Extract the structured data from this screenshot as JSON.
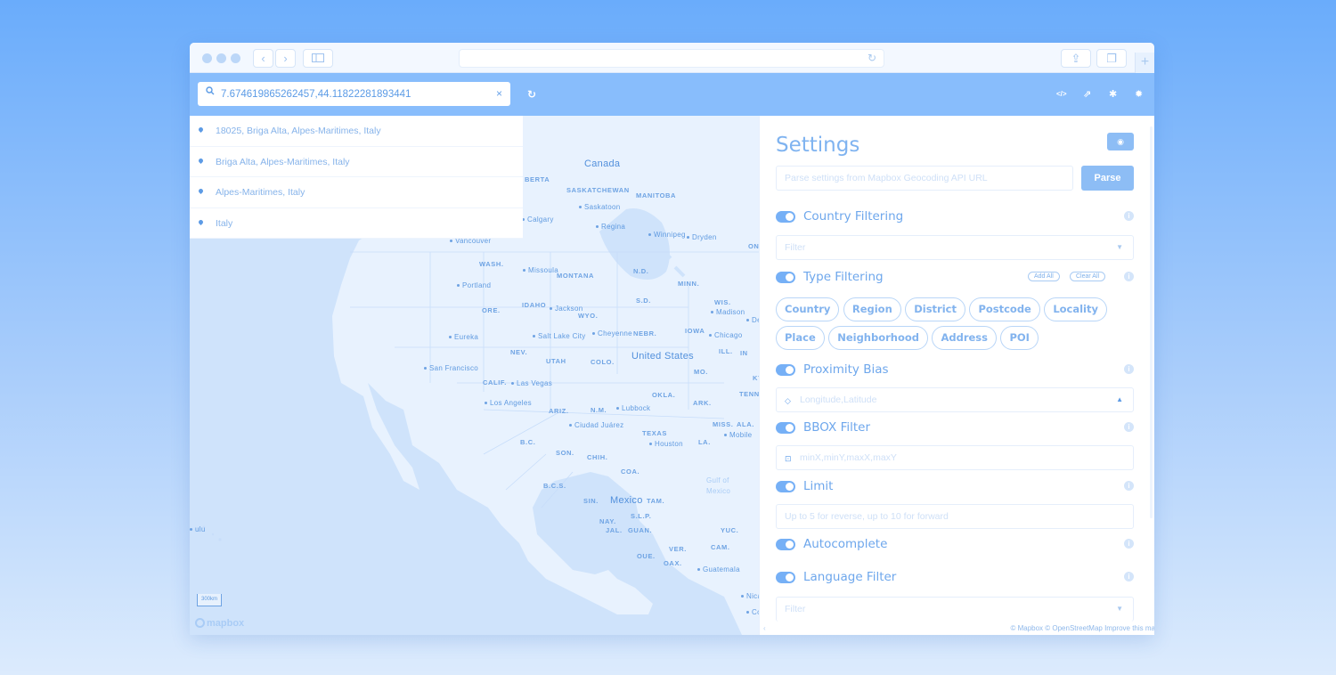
{
  "search": {
    "value": "7.674619865262457,44.11822281893441",
    "clear_label": "×"
  },
  "results": [
    {
      "label": "18025, Briga Alta, Alpes-Maritimes, Italy"
    },
    {
      "label": "Briga Alta, Alpes-Maritimes, Italy"
    },
    {
      "label": "Alpes-Maritimes, Italy"
    },
    {
      "label": "Italy"
    }
  ],
  "map": {
    "countries": [
      "Canada",
      "United States",
      "Mexico"
    ],
    "states": [
      "BERTA",
      "SASKATCHEWAN",
      "MANITOBA",
      "WASH.",
      "MONTANA",
      "N.D.",
      "MINN.",
      "ORE.",
      "IDAHO",
      "WYO.",
      "S.D.",
      "WIS.",
      "NEBR.",
      "IOWA",
      "NEV.",
      "UTAH",
      "COLO.",
      "ILL.",
      "IN",
      "MO.",
      "CALIF.",
      "ARIZ.",
      "N.M.",
      "OKLA.",
      "ARK.",
      "TENN",
      "TEXAS",
      "MISS.",
      "ALA.",
      "LA.",
      "B.C.",
      "SON.",
      "CHIH.",
      "COA.",
      "B.C.S.",
      "SIN.",
      "TAM.",
      "NAY.",
      "S.L.P.",
      "JAL.",
      "GUAN.",
      "YUC.",
      "VER.",
      "CAM.",
      "OUE.",
      "OAX.",
      "ON",
      "KY"
    ],
    "cities": [
      "Calgary",
      "Saskatoon",
      "Regina",
      "Winnipeg",
      "Dryden",
      "Vancouver",
      "Missoula",
      "Portland",
      "Jackson",
      "Madison",
      "Det",
      "Eureka",
      "Salt Lake City",
      "Cheyenne",
      "Chicago",
      "San Francisco",
      "Las Vegas",
      "Los Angeles",
      "Lubbock",
      "Ciudad Juárez",
      "Houston",
      "Mobile",
      "Guatemala",
      "Nicar",
      "Cos",
      "ulu"
    ],
    "water": [
      "Gulf of",
      "Mexico"
    ],
    "scale": "300km",
    "logo": "mapbox"
  },
  "settings": {
    "title": "Settings",
    "parse_placeholder": "Parse settings from Mapbox Geocoding API URL",
    "parse_button": "Parse",
    "country_filtering": {
      "label": "Country Filtering",
      "placeholder": "Filter"
    },
    "type_filtering": {
      "label": "Type Filtering",
      "add_all": "Add All",
      "clear_all": "Clear All",
      "types": [
        "Country",
        "Region",
        "District",
        "Postcode",
        "Locality",
        "Place",
        "Neighborhood",
        "Address",
        "POI"
      ]
    },
    "proximity_bias": {
      "label": "Proximity Bias",
      "placeholder": "Longitude,Latitude"
    },
    "bbox_filter": {
      "label": "BBOX Filter",
      "placeholder": "minX,minY,maxX,maxY"
    },
    "limit": {
      "label": "Limit",
      "placeholder": "Up to 5 for reverse, up to 10 for forward"
    },
    "autocomplete": {
      "label": "Autocomplete"
    },
    "language_filter": {
      "label": "Language Filter",
      "placeholder": "Filter"
    }
  },
  "attribution": "© Mapbox © OpenStreetMap  Improve this ma",
  "colors": {
    "background_top": "#6aacfb",
    "toolbar": "#88bdfc",
    "accent": "#76b0f6",
    "map_water": "#cfe3fb",
    "map_land": "#e8f2fe"
  },
  "icons": {
    "search": "search-icon",
    "refresh": "refresh-icon",
    "code": "code-icon",
    "external": "external-link-icon",
    "bug": "bug-icon",
    "gear": "gear-icon",
    "eye": "eye-icon",
    "pin": "map-pin-icon"
  }
}
